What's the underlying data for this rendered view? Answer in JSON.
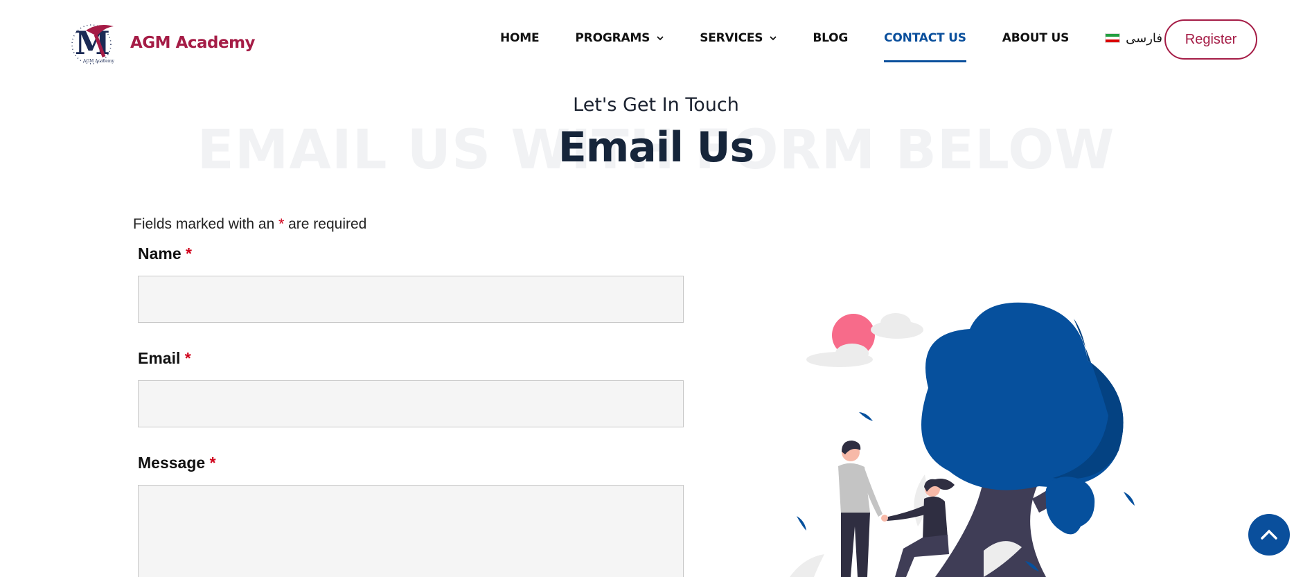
{
  "brand": {
    "name": "AGM Academy",
    "logo_monogram": "M",
    "logo_caption": "AGM Academy",
    "color": "#a51c46"
  },
  "nav": {
    "items": [
      {
        "label": "HOME",
        "has_dropdown": false,
        "active": false
      },
      {
        "label": "PROGRAMS",
        "has_dropdown": true,
        "active": false
      },
      {
        "label": "SERVICES",
        "has_dropdown": true,
        "active": false
      },
      {
        "label": "BLOG",
        "has_dropdown": false,
        "active": false
      },
      {
        "label": "CONTACT US",
        "has_dropdown": false,
        "active": true
      },
      {
        "label": "ABOUT US",
        "has_dropdown": false,
        "active": false
      }
    ],
    "language_label": "فارسی",
    "language_icon": "iran-flag-icon",
    "register_label": "Register",
    "active_color": "#0a4f9c"
  },
  "hero": {
    "subtitle": "Let's Get In Touch",
    "background_title": "EMAIL US WITH FORM BELOW",
    "title": "Email Us"
  },
  "form": {
    "required_note_prefix": "Fields marked with an",
    "required_star": "*",
    "required_note_suffix": "are required",
    "fields": [
      {
        "label": "Name",
        "value": ""
      },
      {
        "label": "Email",
        "value": ""
      },
      {
        "label": "Message",
        "value": ""
      }
    ]
  },
  "scroll_top": {
    "icon": "chevron-up-icon"
  }
}
